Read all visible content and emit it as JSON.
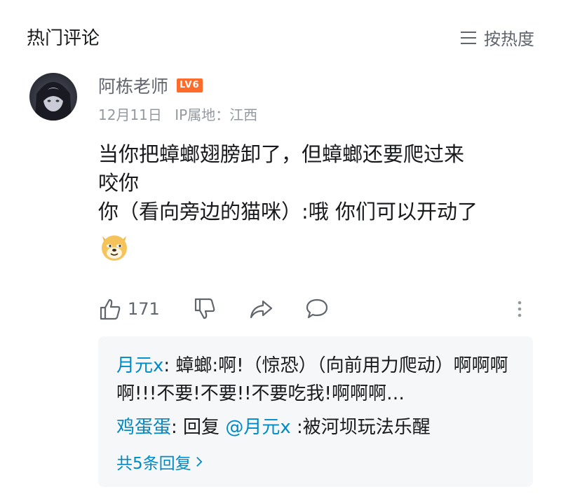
{
  "header": {
    "title": "热门评论",
    "sort_label": "按热度",
    "sort_icon": "menu-lines-icon"
  },
  "comment": {
    "username": "阿栋老师",
    "level": "LV6",
    "date": "12月11日",
    "ip_location": "IP属地：江西",
    "lines": [
      "当你把蟑螂翅膀卸了，但蟑螂还要爬过来",
      "咬你",
      "你（看向旁边的猫咪）:哦 你们可以开动了"
    ],
    "emoji": "doge-emoji",
    "likes": "171"
  },
  "replies": [
    {
      "user": "月元x",
      "text": ": 蟑螂:啊!（惊恐）（向前用力爬动）啊啊啊啊!!!不要!不要!!不要吃我!啊啊啊…"
    },
    {
      "user": "鸡蛋蛋",
      "prefix": ": 回复 ",
      "mention": "@月元x",
      "text": " :被河坝玩法乐醒"
    }
  ],
  "more_replies": "共5条回复",
  "colors": {
    "link": "#008ac5",
    "secondary_text": "#61666d",
    "meta_text": "#9499a0",
    "level_badge": "#ff6b2b",
    "reply_bg": "#f6f7f8"
  }
}
